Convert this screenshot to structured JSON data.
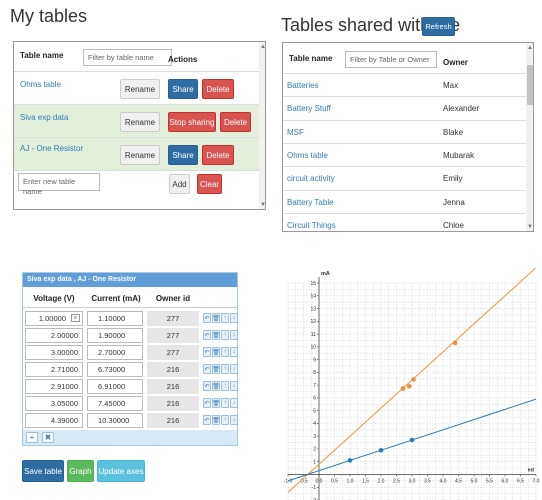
{
  "my_tables": {
    "title": "My tables",
    "header": {
      "name": "Table name",
      "filter_placeholder": "Filter by table name",
      "actions": "Actions"
    },
    "rows": [
      {
        "name": "Ohms table",
        "rename": "Rename",
        "share": "Share",
        "delete": "Delete"
      },
      {
        "name": "Siva exp data",
        "rename": "Rename",
        "share": "Stop sharing",
        "delete": "Delete"
      },
      {
        "name": "AJ - One Resistor",
        "rename": "Rename",
        "share": "Share",
        "delete": "Delete"
      }
    ],
    "new_table_placeholder": "Enter new table name",
    "add": "Add",
    "clear": "Clear"
  },
  "shared": {
    "title": "Tables shared with me",
    "refresh": "Refresh",
    "header": {
      "name": "Table name",
      "filter_placeholder": "Filter by Table or Owner",
      "owner": "Owner"
    },
    "rows": [
      {
        "name": "Batteries",
        "owner": "Max"
      },
      {
        "name": "Battery Stuff",
        "owner": "Alexander"
      },
      {
        "name": "MSF",
        "owner": "Blake"
      },
      {
        "name": "Ohms table",
        "owner": "Mubarak"
      },
      {
        "name": "circuit activity",
        "owner": "Emily"
      },
      {
        "name": "Battery Table",
        "owner": "Jenna"
      },
      {
        "name": "Circuit Things",
        "owner": "Chloe"
      }
    ]
  },
  "grid": {
    "title": "Siva exp data , AJ - One Resistor",
    "columns": [
      "Voltage (V)",
      "Current (mA)",
      "Owner id"
    ],
    "rows": [
      {
        "v": "1.00000",
        "c": "1.10000",
        "o": "277"
      },
      {
        "v": "2.00000",
        "c": "1.90000",
        "o": "277"
      },
      {
        "v": "3.00000",
        "c": "2.70000",
        "o": "277"
      },
      {
        "v": "2.71000",
        "c": "6.73000",
        "o": "216"
      },
      {
        "v": "2.91000",
        "c": "6.91000",
        "o": "216"
      },
      {
        "v": "3.05000",
        "c": "7.45000",
        "o": "216"
      },
      {
        "v": "4.39000",
        "c": "10.30000",
        "o": "216"
      }
    ],
    "row_icons": [
      "↶",
      "🗑",
      "↑",
      "↓"
    ],
    "foot_icons": [
      "+",
      "✖"
    ]
  },
  "buttons": {
    "save": "Save table",
    "graph": "Graph",
    "update_axes": "Update axes"
  },
  "chart_data": {
    "type": "scatter",
    "xlabel": "ed",
    "ylabel": "mA",
    "xlim": [
      -1.0,
      7.0
    ],
    "ylim": [
      -2,
      15
    ],
    "x_ticks": [
      "-1.0",
      "-0.5",
      "0.0",
      "0.5",
      "1.0",
      "1.5",
      "2.0",
      "2.5",
      "3.0",
      "3.5",
      "4.0",
      "4.5",
      "5.0",
      "5.5",
      "6.0",
      "6.5",
      "7.0"
    ],
    "y_ticks": [
      "-2",
      "-1",
      "1",
      "2",
      "3",
      "4",
      "5",
      "6",
      "7",
      "8",
      "9",
      "10",
      "11",
      "12",
      "13",
      "14",
      "15"
    ],
    "grid": true,
    "series": [
      {
        "color": "#f0913b",
        "points": [
          [
            2.71,
            6.73
          ],
          [
            2.91,
            6.91
          ],
          [
            3.05,
            7.45
          ],
          [
            4.39,
            10.3
          ]
        ],
        "fit": {
          "slope": 2.2,
          "intercept": 0.8
        }
      },
      {
        "color": "#2f7ab8",
        "points": [
          [
            1.0,
            1.1
          ],
          [
            2.0,
            1.9
          ],
          [
            3.0,
            2.7
          ]
        ],
        "fit": {
          "slope": 0.8,
          "intercept": 0.3
        }
      }
    ]
  }
}
